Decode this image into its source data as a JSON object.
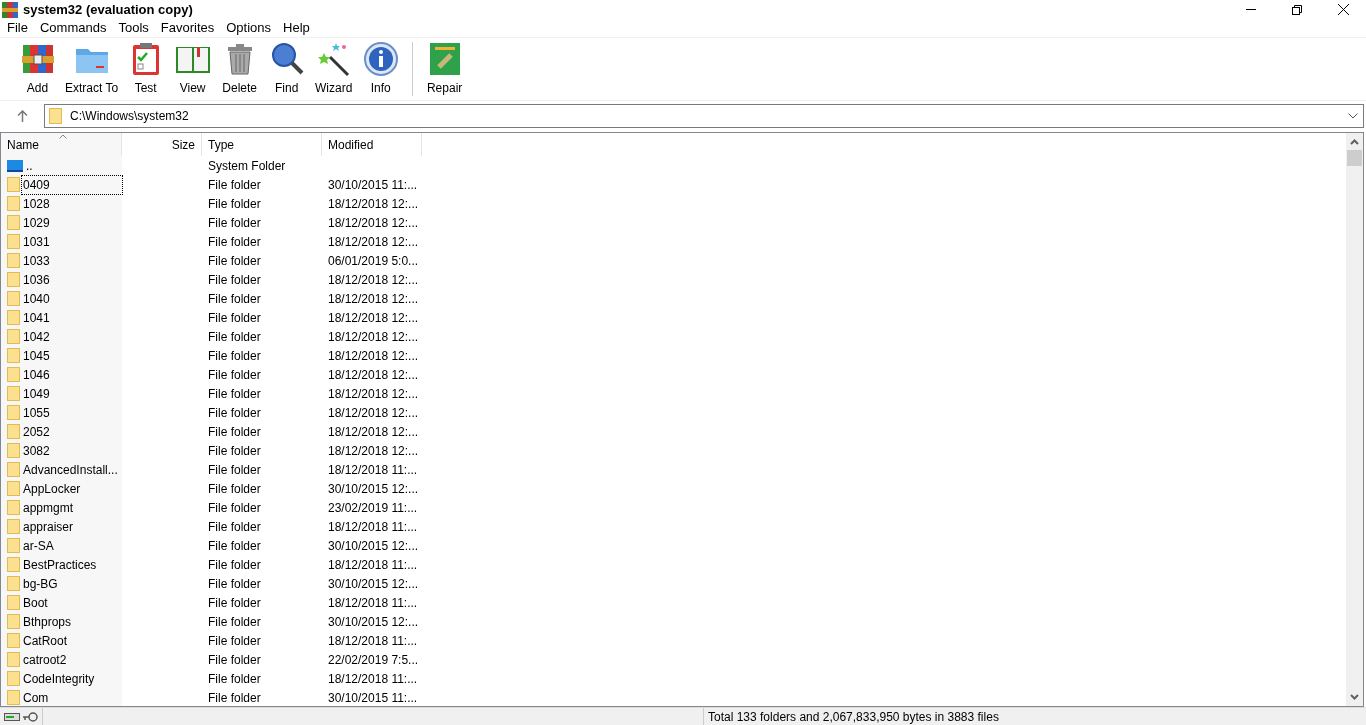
{
  "window": {
    "title": "system32 (evaluation copy)"
  },
  "menu": [
    "File",
    "Commands",
    "Tools",
    "Favorites",
    "Options",
    "Help"
  ],
  "toolbar": [
    {
      "kind": "add",
      "label": "Add"
    },
    {
      "kind": "extract",
      "label": "Extract To"
    },
    {
      "kind": "test",
      "label": "Test"
    },
    {
      "kind": "view",
      "label": "View"
    },
    {
      "kind": "delete",
      "label": "Delete"
    },
    {
      "kind": "find",
      "label": "Find"
    },
    {
      "kind": "wizard",
      "label": "Wizard"
    },
    {
      "kind": "info",
      "label": "Info"
    },
    {
      "kind": "repair",
      "label": "Repair"
    }
  ],
  "address": {
    "value": "C:\\Windows\\system32"
  },
  "table": {
    "columns": [
      "Name",
      "Size",
      "Type",
      "Modified"
    ],
    "rows": [
      {
        "kind": "parent",
        "name": "..",
        "type": "System Folder",
        "modified": "",
        "focused": false
      },
      {
        "kind": "folder",
        "name": "0409",
        "type": "File folder",
        "modified": "30/10/2015 11:...",
        "focused": true
      },
      {
        "kind": "folder",
        "name": "1028",
        "type": "File folder",
        "modified": "18/12/2018 12:...",
        "focused": false
      },
      {
        "kind": "folder",
        "name": "1029",
        "type": "File folder",
        "modified": "18/12/2018 12:...",
        "focused": false
      },
      {
        "kind": "folder",
        "name": "1031",
        "type": "File folder",
        "modified": "18/12/2018 12:...",
        "focused": false
      },
      {
        "kind": "folder",
        "name": "1033",
        "type": "File folder",
        "modified": "06/01/2019 5:0...",
        "focused": false
      },
      {
        "kind": "folder",
        "name": "1036",
        "type": "File folder",
        "modified": "18/12/2018 12:...",
        "focused": false
      },
      {
        "kind": "folder",
        "name": "1040",
        "type": "File folder",
        "modified": "18/12/2018 12:...",
        "focused": false
      },
      {
        "kind": "folder",
        "name": "1041",
        "type": "File folder",
        "modified": "18/12/2018 12:...",
        "focused": false
      },
      {
        "kind": "folder",
        "name": "1042",
        "type": "File folder",
        "modified": "18/12/2018 12:...",
        "focused": false
      },
      {
        "kind": "folder",
        "name": "1045",
        "type": "File folder",
        "modified": "18/12/2018 12:...",
        "focused": false
      },
      {
        "kind": "folder",
        "name": "1046",
        "type": "File folder",
        "modified": "18/12/2018 12:...",
        "focused": false
      },
      {
        "kind": "folder",
        "name": "1049",
        "type": "File folder",
        "modified": "18/12/2018 12:...",
        "focused": false
      },
      {
        "kind": "folder",
        "name": "1055",
        "type": "File folder",
        "modified": "18/12/2018 12:...",
        "focused": false
      },
      {
        "kind": "folder",
        "name": "2052",
        "type": "File folder",
        "modified": "18/12/2018 12:...",
        "focused": false
      },
      {
        "kind": "folder",
        "name": "3082",
        "type": "File folder",
        "modified": "18/12/2018 12:...",
        "focused": false
      },
      {
        "kind": "folder",
        "name": "AdvancedInstall...",
        "type": "File folder",
        "modified": "18/12/2018 11:...",
        "focused": false
      },
      {
        "kind": "folder",
        "name": "AppLocker",
        "type": "File folder",
        "modified": "30/10/2015 12:...",
        "focused": false
      },
      {
        "kind": "folder",
        "name": "appmgmt",
        "type": "File folder",
        "modified": "23/02/2019 11:...",
        "focused": false
      },
      {
        "kind": "folder",
        "name": "appraiser",
        "type": "File folder",
        "modified": "18/12/2018 11:...",
        "focused": false
      },
      {
        "kind": "folder",
        "name": "ar-SA",
        "type": "File folder",
        "modified": "30/10/2015 12:...",
        "focused": false
      },
      {
        "kind": "folder",
        "name": "BestPractices",
        "type": "File folder",
        "modified": "18/12/2018 11:...",
        "focused": false
      },
      {
        "kind": "folder",
        "name": "bg-BG",
        "type": "File folder",
        "modified": "30/10/2015 12:...",
        "focused": false
      },
      {
        "kind": "folder",
        "name": "Boot",
        "type": "File folder",
        "modified": "18/12/2018 11:...",
        "focused": false
      },
      {
        "kind": "folder",
        "name": "Bthprops",
        "type": "File folder",
        "modified": "30/10/2015 12:...",
        "focused": false
      },
      {
        "kind": "folder",
        "name": "CatRoot",
        "type": "File folder",
        "modified": "18/12/2018 11:...",
        "focused": false
      },
      {
        "kind": "folder",
        "name": "catroot2",
        "type": "File folder",
        "modified": "22/02/2019 7:5...",
        "focused": false
      },
      {
        "kind": "folder",
        "name": "CodeIntegrity",
        "type": "File folder",
        "modified": "18/12/2018 11:...",
        "focused": false
      },
      {
        "kind": "folder",
        "name": "Com",
        "type": "File folder",
        "modified": "30/10/2015 11:...",
        "focused": false
      }
    ]
  },
  "status_bar": {
    "text": "Total 133 folders and 2,067,833,950 bytes in 3883 files"
  }
}
